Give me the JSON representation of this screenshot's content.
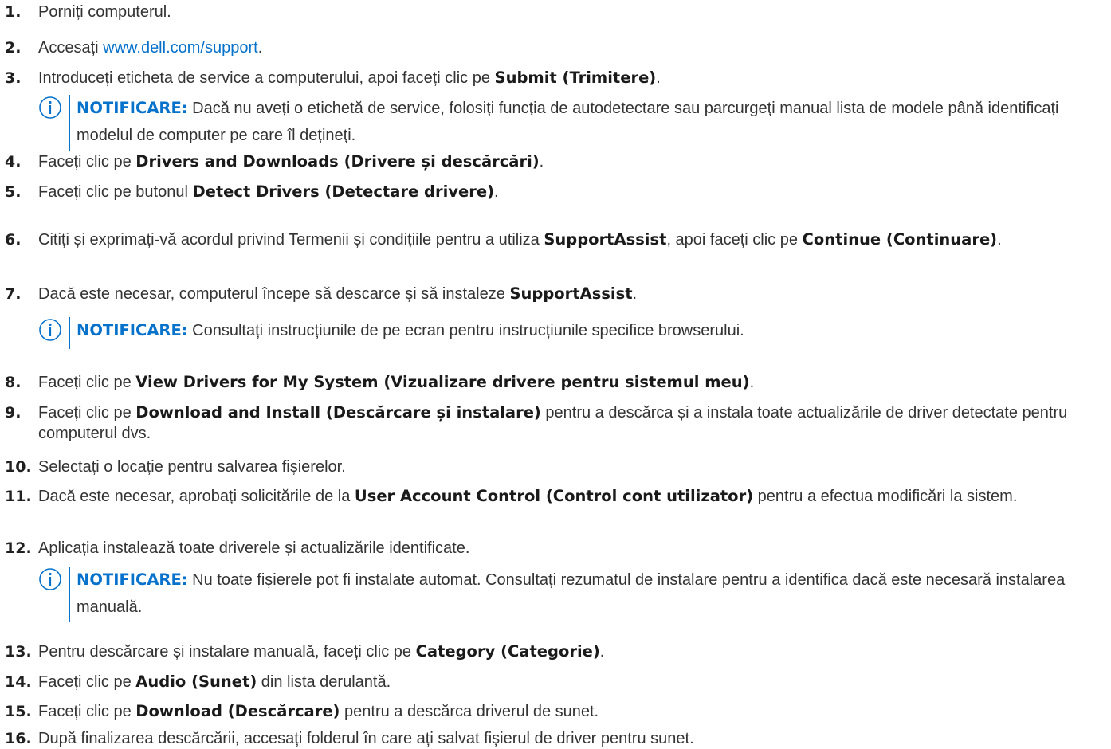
{
  "steps": [
    {
      "n": "1.",
      "parts": [
        "Porniți computerul."
      ]
    },
    {
      "n": "2.",
      "parts": [
        "Accesați ",
        "www.dell.com/support",
        "."
      ]
    },
    {
      "n": "3.",
      "parts": [
        "Introduceți eticheta de service a computerului, apoi faceți clic pe ",
        "Submit (Trimitere)",
        "."
      ]
    },
    {
      "n": "4.",
      "parts": [
        "Faceți clic pe ",
        "Drivers and Downloads (Drivere și descărcări)",
        "."
      ]
    },
    {
      "n": "5.",
      "parts": [
        "Faceți clic pe butonul ",
        "Detect Drivers (Detectare drivere)",
        "."
      ]
    },
    {
      "n": "6.",
      "parts": [
        "Citiți și exprimați-vă acordul privind Termenii și condițiile pentru a utiliza ",
        "SupportAssist",
        ", apoi faceți clic pe ",
        "Continue (Continuare)",
        "."
      ]
    },
    {
      "n": "7.",
      "parts": [
        "Dacă este necesar, computerul începe să descarce și să instaleze ",
        "SupportAssist",
        "."
      ]
    },
    {
      "n": "8.",
      "parts": [
        "Faceți clic pe ",
        "View Drivers for My System (Vizualizare drivere pentru sistemul meu)",
        "."
      ]
    },
    {
      "n": "9.",
      "parts": [
        "Faceți clic pe ",
        "Download and Install (Descărcare și instalare)",
        " pentru a descărca și a instala toate actualizările de driver detectate pentru computerul dvs."
      ]
    },
    {
      "n": "10.",
      "parts": [
        "Selectați o locație pentru salvarea fișierelor."
      ]
    },
    {
      "n": "11.",
      "parts": [
        "Dacă este necesar, aprobați solicitările de la ",
        "User Account Control (Control cont utilizator)",
        " pentru a efectua modificări la sistem."
      ]
    },
    {
      "n": "12.",
      "parts": [
        "Aplicația instalează toate driverele și actualizările identificate."
      ]
    },
    {
      "n": "13.",
      "parts": [
        "Pentru descărcare și instalare manuală, faceți clic pe ",
        "Category (Categorie)",
        "."
      ]
    },
    {
      "n": "14.",
      "parts": [
        "Faceți clic pe ",
        "Audio (Sunet)",
        " din lista derulantă."
      ]
    },
    {
      "n": "15.",
      "parts": [
        "Faceți clic pe ",
        "Download (Descărcare)",
        " pentru a descărca driverul de sunet."
      ]
    },
    {
      "n": "16.",
      "parts": [
        "După finalizarea descărcării, accesați folderul în care ați salvat fișierul de driver pentru sunet."
      ]
    }
  ],
  "notes": [
    {
      "label": "NOTIFICARE:",
      "text": " Dacă nu aveți o etichetă de service, folosiți funcția de autodetectare sau parcurgeți manual lista de modele până identificați modelul de computer pe care îl dețineți."
    },
    {
      "label": "NOTIFICARE:",
      "text": " Consultați instrucțiunile de pe ecran pentru instrucțiunile specifice browserului."
    },
    {
      "label": "NOTIFICARE:",
      "text": " Nu toate fișierele pot fi instalate automat. Consultați rezumatul de instalare pentru a identifica dacă este necesară instalarea manuală."
    }
  ],
  "colors": {
    "accent": "#0672cb",
    "text": "#333333"
  },
  "icons": {
    "note": "info-circle-icon"
  }
}
